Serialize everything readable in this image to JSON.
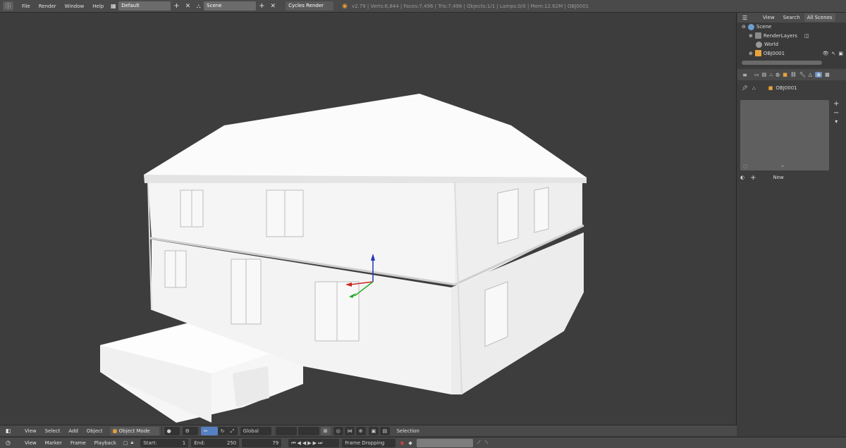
{
  "colors": {
    "header_bg": "#4a4a4a",
    "viewport_bg": "#3d3d3d",
    "active_field": "#6b6b6b",
    "axis_x": "#cc2222",
    "axis_y": "#22aa22",
    "axis_z": "#2233bb"
  },
  "topbar": {
    "menus": [
      "File",
      "Render",
      "Window",
      "Help"
    ],
    "layout_name": "Default",
    "scene_name": "Scene",
    "engine": "Cycles Render",
    "stats": "v2.79 | Verts:6,844 | Faces:7,496 | Tris:7,496 | Objects:1/1 | Lamps:0/0 | Mem:12.62M | OBJ0001"
  },
  "outliner": {
    "header": {
      "view": "View",
      "search": "Search",
      "filter": "All Scenes"
    },
    "items": [
      "Scene",
      "RenderLayers",
      "World",
      "OBJ0001"
    ]
  },
  "properties": {
    "object_name": "OBJ0001",
    "new_label": "New"
  },
  "viewport_header": {
    "menus": [
      "View",
      "Select",
      "Add",
      "Object"
    ],
    "mode": "Object Mode",
    "orientation": "Global",
    "selection": "Selection"
  },
  "timeline": {
    "menus": [
      "View",
      "Marker",
      "Frame",
      "Playback"
    ],
    "start_label": "Start:",
    "start_value": "1",
    "end_label": "End:",
    "end_value": "250",
    "current_frame": "79",
    "sync": "Frame Dropping"
  },
  "icons": [
    "info-icon",
    "layout-icon",
    "scene-icon",
    "blender-logo-icon",
    "cube-icon",
    "camera-icon",
    "world-icon",
    "render-icon",
    "pin-icon",
    "material-icon",
    "add-icon",
    "remove-icon",
    "play-icon"
  ]
}
